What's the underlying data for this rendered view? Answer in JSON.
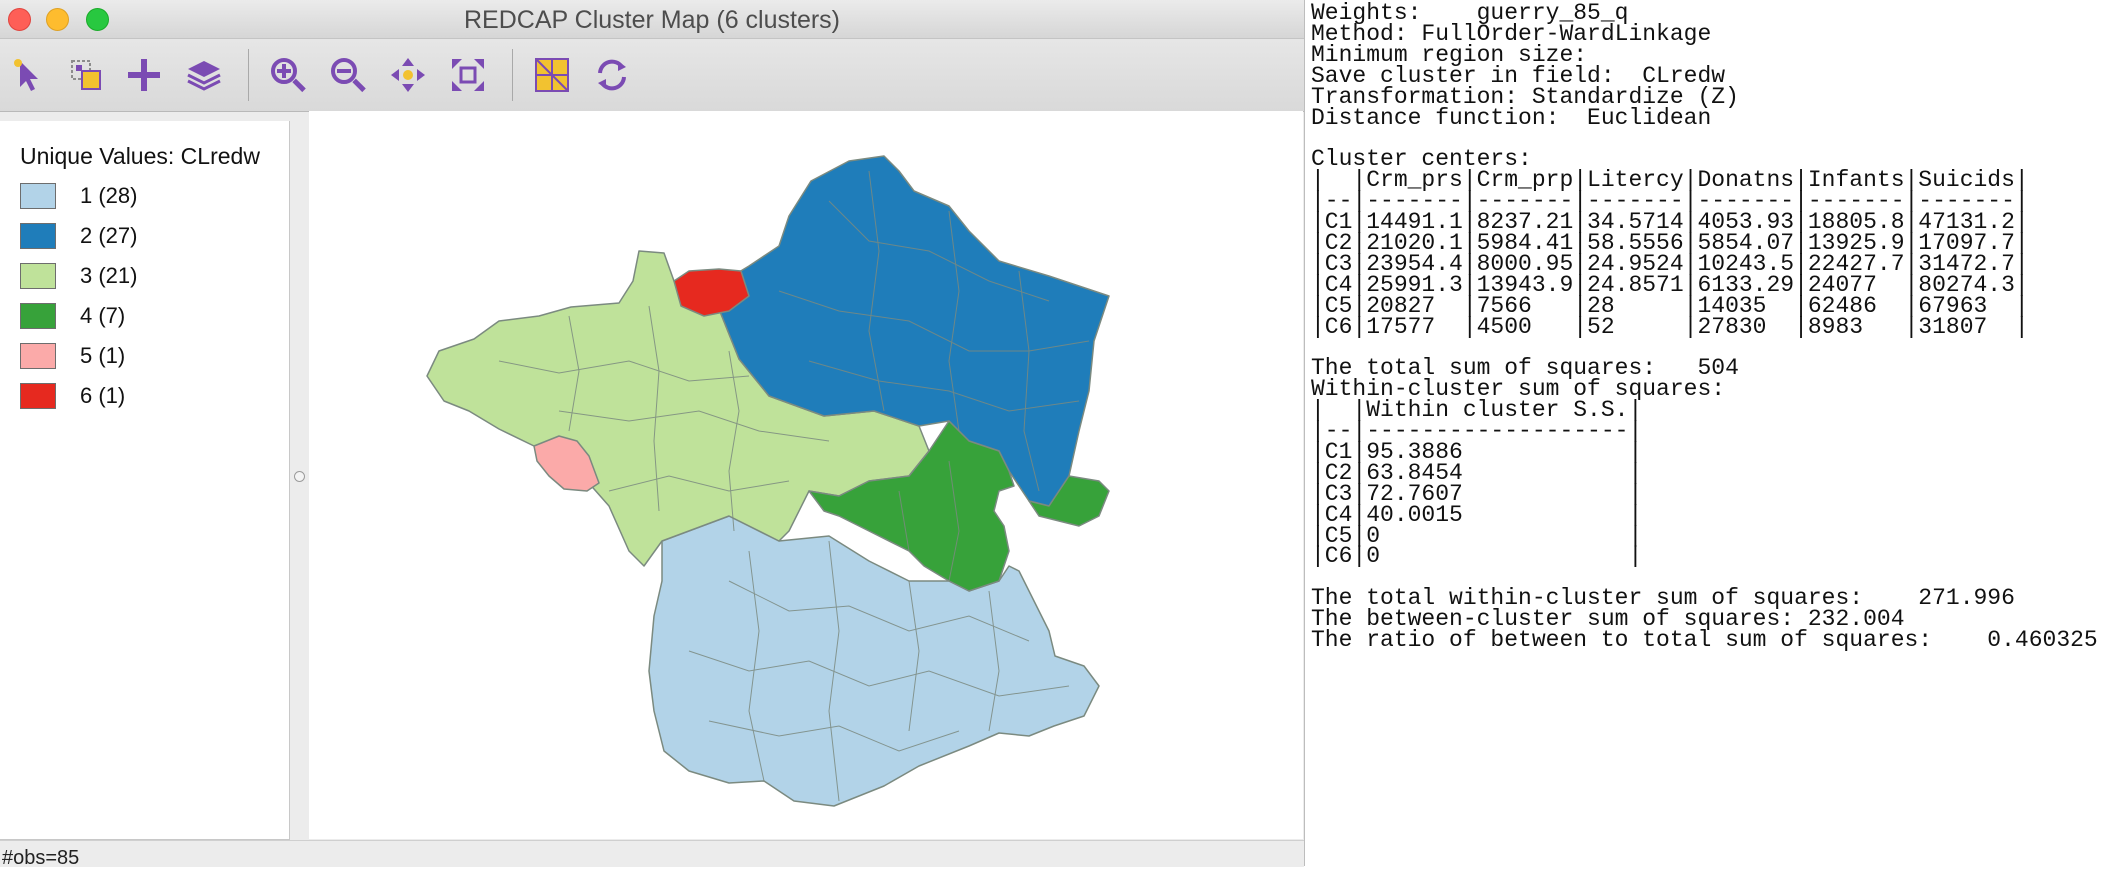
{
  "window": {
    "title": "REDCAP Cluster Map (6 clusters)"
  },
  "toolbar": {
    "tools": [
      {
        "name": "select-pointer-icon"
      },
      {
        "name": "selection-mode-icon"
      },
      {
        "name": "add-layer-plus-icon"
      },
      {
        "name": "layers-icon"
      },
      {
        "name": "zoom-in-icon"
      },
      {
        "name": "zoom-out-icon"
      },
      {
        "name": "pan-icon"
      },
      {
        "name": "fit-extent-icon"
      },
      {
        "name": "basemap-icon"
      },
      {
        "name": "refresh-icon"
      }
    ]
  },
  "legend": {
    "title": "Unique Values: CLredw",
    "items": [
      {
        "label": "1 (28)",
        "color": "#b2d3e8"
      },
      {
        "label": "2 (27)",
        "color": "#1f7dba"
      },
      {
        "label": "3 (21)",
        "color": "#bfe29a"
      },
      {
        "label": "4 (7)",
        "color": "#37a23a"
      },
      {
        "label": "5 (1)",
        "color": "#fbaaa9"
      },
      {
        "label": "6 (1)",
        "color": "#e6291f"
      }
    ]
  },
  "map": {
    "border_color": "#7b8a80"
  },
  "status": {
    "text": "#obs=85"
  },
  "report": {
    "lines": [
      "Weights:    guerry_85_q",
      "Method: FullOrder-WardLinkage",
      "Minimum region size:",
      "Save cluster in field:  CLredw",
      "Transformation: Standardize (Z)",
      "Distance function:  Euclidean",
      "",
      "Cluster centers:",
      "|  |Crm_prs|Crm_prp|Litercy|Donatns|Infants|Suicids|",
      "|--|-------|-------|-------|-------|-------|-------|",
      "|C1|14491.1|8237.21|34.5714|4053.93|18805.8|47131.2|",
      "|C2|21020.1|5984.41|58.5556|5854.07|13925.9|17097.7|",
      "|C3|23954.4|8000.95|24.9524|10243.5|22427.7|31472.7|",
      "|C4|25991.3|13943.9|24.8571|6133.29|24077  |80274.3|",
      "|C5|20827  |7566   |28     |14035  |62486  |67963  |",
      "|C6|17577  |4500   |52     |27830  |8983   |31807  |",
      "",
      "The total sum of squares:   504",
      "Within-cluster sum of squares:",
      "|  |Within cluster S.S.|",
      "|--|-------------------|",
      "|C1|95.3886            |",
      "|C2|63.8454            |",
      "|C3|72.7607            |",
      "|C4|40.0015            |",
      "|C5|0                  |",
      "|C6|0                  |",
      "",
      "The total within-cluster sum of squares:    271.996",
      "The between-cluster sum of squares: 232.004",
      "The ratio of between to total sum of squares:    0.460325"
    ]
  }
}
